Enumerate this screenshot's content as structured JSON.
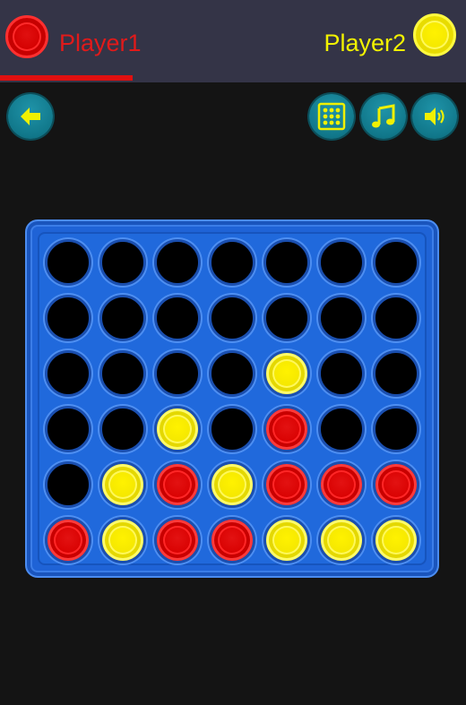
{
  "header": {
    "player1": {
      "name": "Player1",
      "color": "#e11a1a",
      "active": true
    },
    "player2": {
      "name": "Player2",
      "color": "#f2f200",
      "active": false
    }
  },
  "toolbar": {
    "back_icon": "arrow-left-icon",
    "buttons": [
      {
        "name": "grid-button",
        "icon": "grid-icon"
      },
      {
        "name": "music-button",
        "icon": "music-note-icon"
      },
      {
        "name": "sound-button",
        "icon": "speaker-icon"
      }
    ]
  },
  "board": {
    "columns": 7,
    "rows": 6,
    "colors": {
      "red": "#d80000",
      "yellow": "#f3e600",
      "empty": "#000000",
      "frame": "#1f63d6"
    },
    "cells": [
      [
        "empty",
        "empty",
        "empty",
        "empty",
        "empty",
        "empty",
        "empty"
      ],
      [
        "empty",
        "empty",
        "empty",
        "empty",
        "empty",
        "empty",
        "empty"
      ],
      [
        "empty",
        "empty",
        "empty",
        "empty",
        "yellow",
        "empty",
        "empty"
      ],
      [
        "empty",
        "empty",
        "yellow",
        "empty",
        "red",
        "empty",
        "empty"
      ],
      [
        "empty",
        "yellow",
        "red",
        "yellow",
        "red",
        "red",
        "red"
      ],
      [
        "red",
        "yellow",
        "red",
        "red",
        "yellow",
        "yellow",
        "yellow"
      ]
    ]
  }
}
